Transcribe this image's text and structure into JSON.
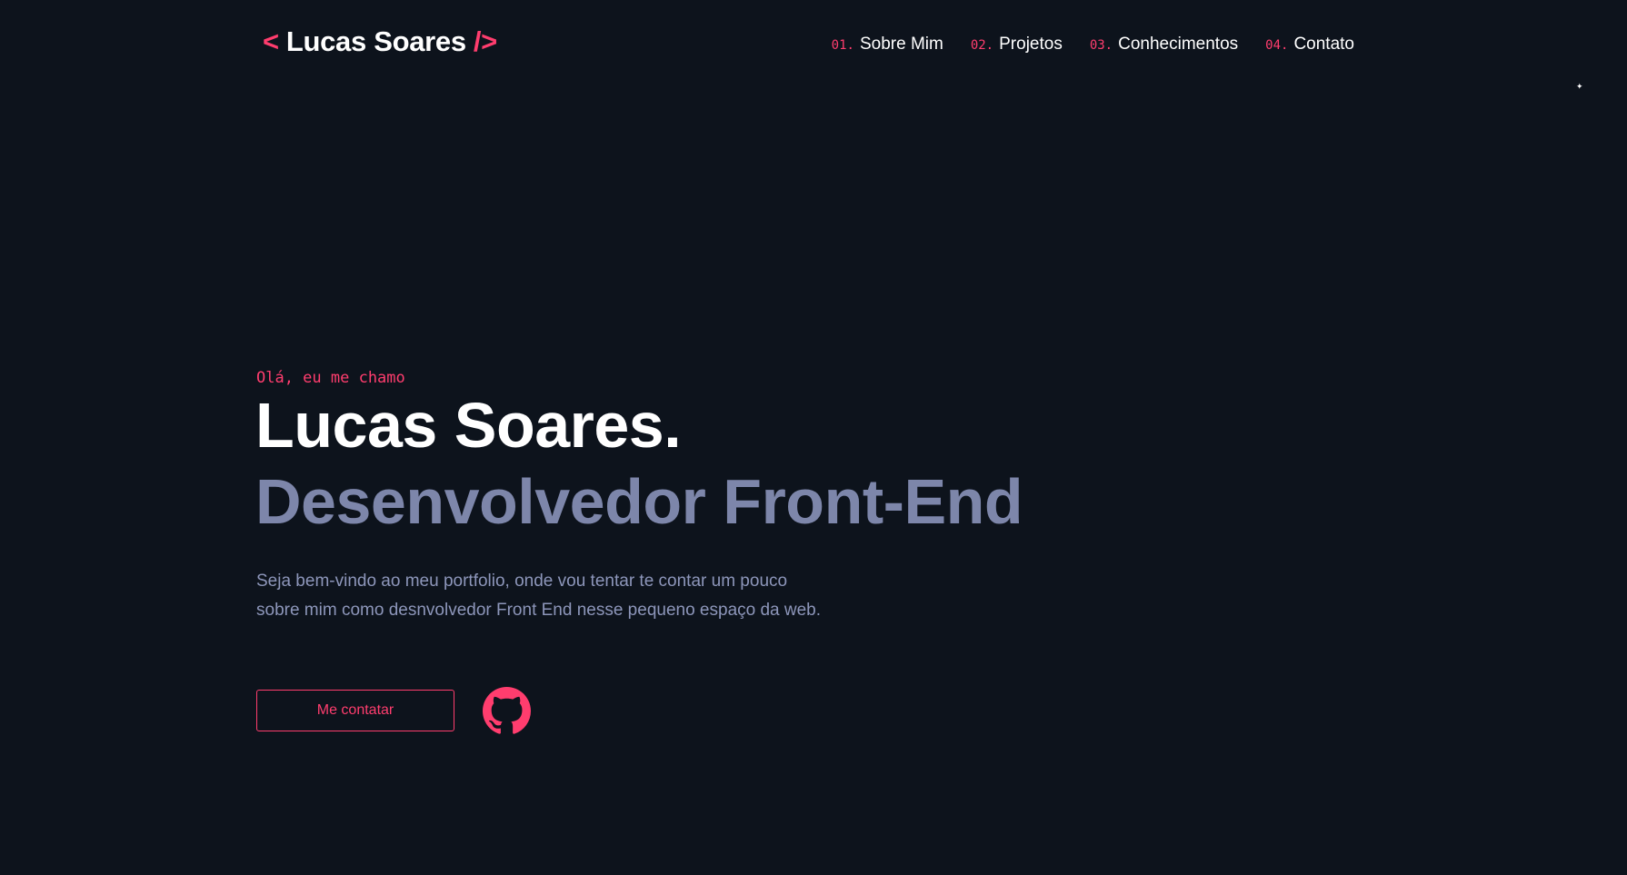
{
  "header": {
    "logo": {
      "open_bracket": "<",
      "name": "Lucas Soares",
      "close_bracket": "/>"
    },
    "nav": [
      {
        "num": "01.",
        "label": "Sobre Mim"
      },
      {
        "num": "02.",
        "label": "Projetos"
      },
      {
        "num": "03.",
        "label": "Conhecimentos"
      },
      {
        "num": "04.",
        "label": "Contato"
      }
    ]
  },
  "hero": {
    "greeting": "Olá, eu me chamo",
    "name": "Lucas Soares.",
    "role": "Desenvolvedor Front-End",
    "intro_line1": "Seja bem-vindo ao meu portfolio, onde vou tentar te contar um pouco",
    "intro_line2": "sobre mim como desnvolvedor Front End nesse pequeno espaço da web.",
    "contact_button": "Me contatar",
    "github_icon": "github-icon"
  },
  "colors": {
    "background": "#0d131c",
    "accent": "#ff3d6e",
    "role_text": "#7d86aa",
    "body_text": "#8d96ba",
    "heading_text": "#ffffff"
  }
}
